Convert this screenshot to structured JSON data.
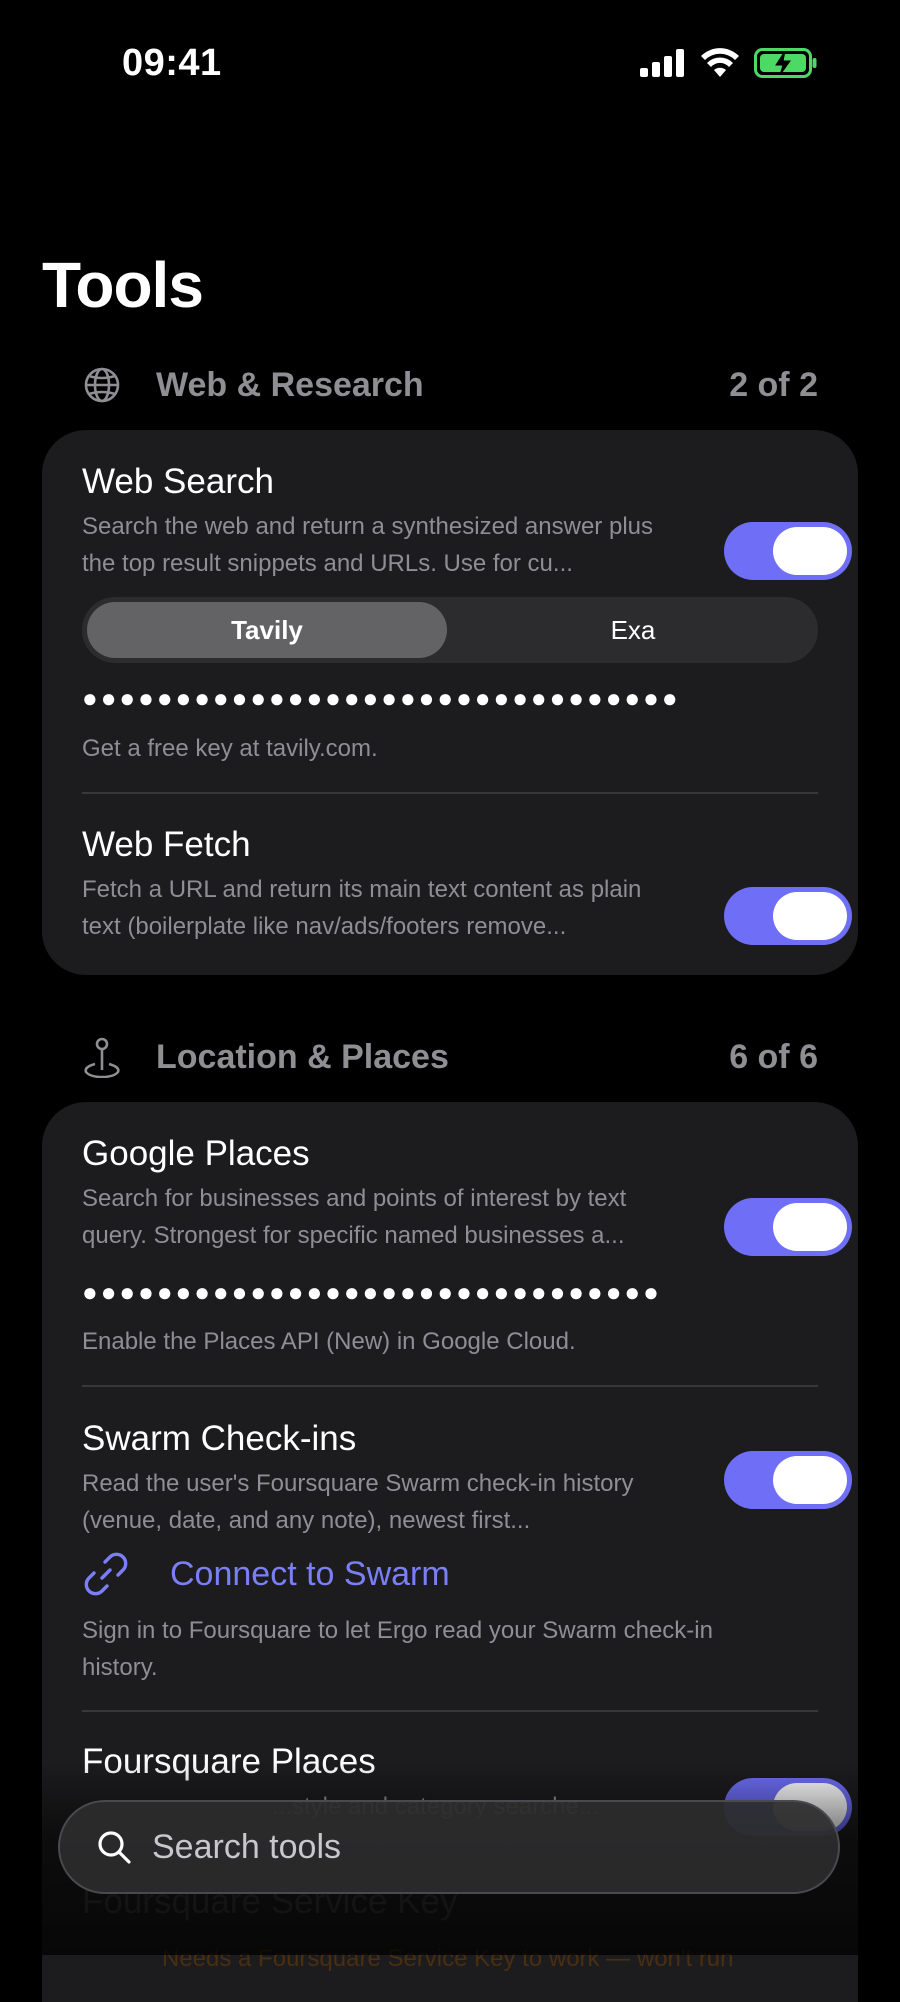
{
  "status_bar": {
    "time": "09:41"
  },
  "page": {
    "title": "Tools"
  },
  "sections": [
    {
      "title": "Web & Research",
      "count": "2 of 2",
      "icon": "globe-icon",
      "tools": [
        {
          "name": "Web Search",
          "description": "Search the web and return a synthesized answer plus the top result snippets and URLs. Use for cu...",
          "enabled": true,
          "provider_options": [
            "Tavily",
            "Exa"
          ],
          "selected_provider": "Tavily",
          "api_key_masked": "●●●●●●●●●●●●●●●●●●●●●●●●●●●●●●●●",
          "hint": "Get a free key at tavily.com."
        },
        {
          "name": "Web Fetch",
          "description": "Fetch a URL and return its main text content as plain text (boilerplate like nav/ads/footers remove...",
          "enabled": true
        }
      ]
    },
    {
      "title": "Location & Places",
      "count": "6 of 6",
      "icon": "map-pin-icon",
      "tools": [
        {
          "name": "Google Places",
          "description": "Search for businesses and points of interest by text query. Strongest for specific named businesses a...",
          "enabled": true,
          "api_key_masked": "●●●●●●●●●●●●●●●●●●●●●●●●●●●●●●●",
          "hint": "Enable the Places API (New) in Google Cloud."
        },
        {
          "name": "Swarm Check-ins",
          "description": "Read the user's Foursquare Swarm check-in history (venue, date, and any note), newest first...",
          "enabled": true,
          "connect_label": "Connect to Swarm",
          "hint": "Sign in to Foursquare to let Ergo read your Swarm check-in history."
        },
        {
          "name": "Foursquare Places",
          "description": "...style and category searche...",
          "enabled": true
        },
        {
          "name": "Foursquare Service Key",
          "hint": "Needs a Foursquare Service Key to work — won't run"
        }
      ]
    }
  ],
  "search": {
    "placeholder": "Search tools"
  }
}
